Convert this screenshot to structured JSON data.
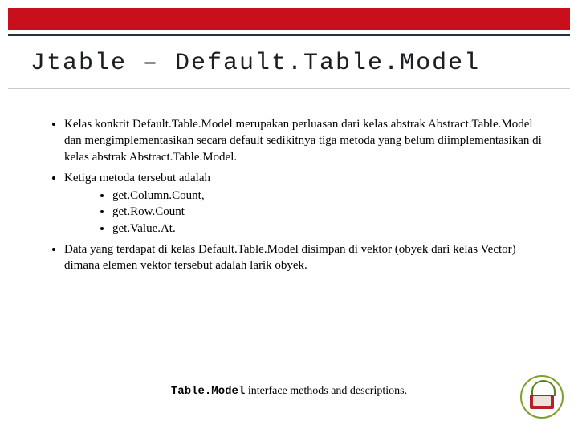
{
  "title": "Jtable – Default.Table.Model",
  "bullets": [
    {
      "text": "Kelas konkrit Default.Table.Model merupakan perluasan dari kelas abstrak Abstract.Table.Model dan mengimplementasikan secara default sedikitnya tiga metoda yang belum diimplementasikan di kelas abstrak Abstract.Table.Model."
    },
    {
      "text": "Ketiga metoda tersebut adalah",
      "sub": [
        "get.Column.Count,",
        "get.Row.Count",
        "get.Value.At."
      ]
    },
    {
      "text": "Data yang terdapat di kelas Default.Table.Model disimpan di vektor (obyek dari kelas Vector) dimana elemen vektor tersebut adalah larik obyek."
    }
  ],
  "caption": {
    "code": "Table.Model",
    "text": "  interface methods and descriptions."
  }
}
